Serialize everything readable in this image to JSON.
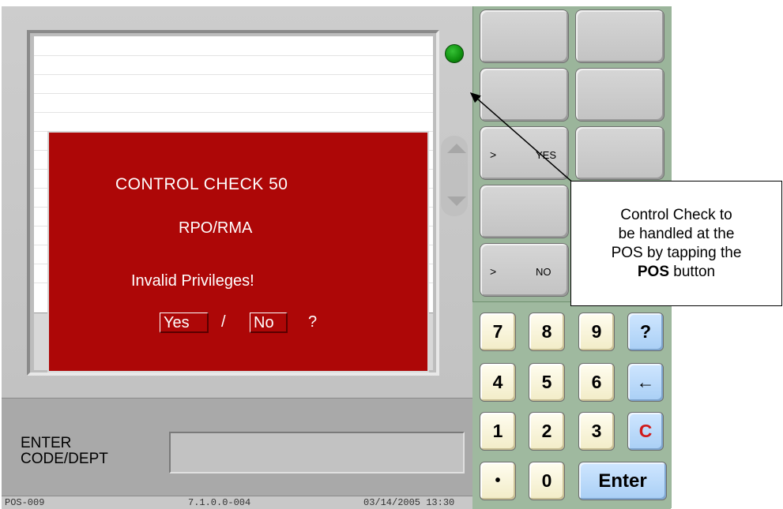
{
  "dialog": {
    "title": "CONTROL CHECK 50",
    "subtitle": "RPO/RMA",
    "message": "Invalid Privileges!",
    "yes_label": "Yes",
    "separator": "/",
    "no_label": "No",
    "question_mark": "?"
  },
  "entry": {
    "label": "ENTER\nCODE/DEPT",
    "value": ""
  },
  "status_bar": {
    "terminal": "POS-009",
    "version": "7.1.0.0-004",
    "datetime": "03/14/2005 13:30"
  },
  "function_buttons": [
    {
      "arrow": "",
      "label": ""
    },
    {
      "arrow": "",
      "label": ""
    },
    {
      "arrow": "",
      "label": ""
    },
    {
      "arrow": "",
      "label": ""
    },
    {
      "arrow": ">",
      "label": "YES"
    },
    {
      "arrow": "",
      "label": ""
    },
    {
      "arrow": "",
      "label": ""
    },
    {
      "arrow": ">",
      "label": "NO"
    }
  ],
  "keypad": {
    "k7": "7",
    "k8": "8",
    "k9": "9",
    "help": "?",
    "k4": "4",
    "k5": "5",
    "k6": "6",
    "back": "←",
    "k1": "1",
    "k2": "2",
    "k3": "3",
    "clear": "C",
    "dot": "•",
    "k0": "0",
    "enter": "Enter"
  },
  "callout": {
    "line1": "Control Check to",
    "line2": "be handled at the",
    "line3": "POS by tapping the",
    "bold_word": "POS",
    "line4_suffix": " button"
  },
  "colors": {
    "dialog_bg": "#ad0707",
    "panel_bg": "#9bb59b",
    "key_cream": "#f2ecc7",
    "key_blue": "#a9cff5",
    "status_led": "#1aa31a"
  }
}
